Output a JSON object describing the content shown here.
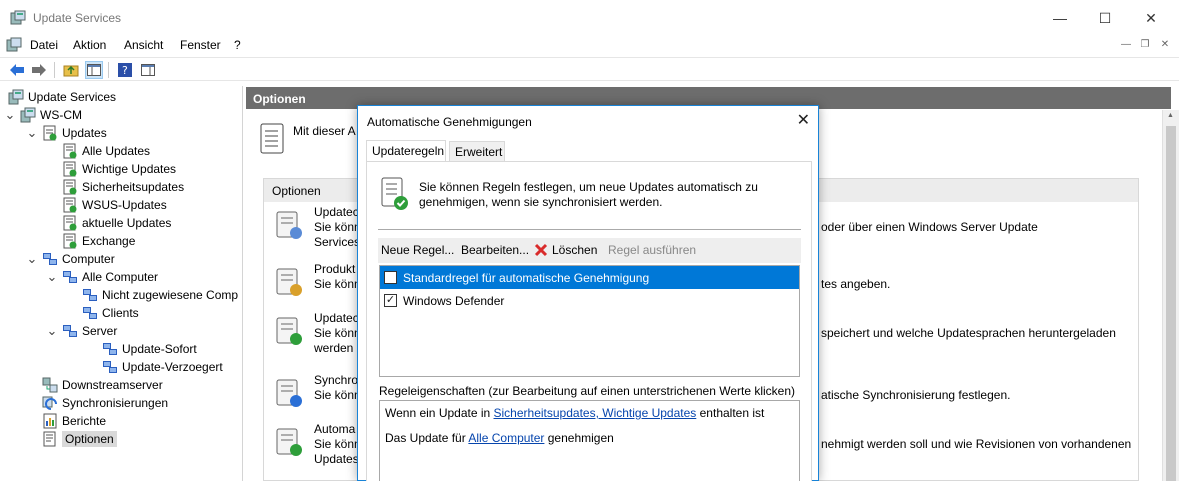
{
  "window": {
    "title": "Update Services"
  },
  "menu": {
    "items": [
      "Datei",
      "Aktion",
      "Ansicht",
      "Fenster",
      "?"
    ]
  },
  "tree": {
    "nodes": [
      {
        "label": "Update Services",
        "icon": "server-icon",
        "chev": ""
      },
      {
        "label": "WS-CM",
        "icon": "server-icon",
        "chev": "down"
      },
      {
        "label": "Updates",
        "icon": "updates-icon",
        "chev": "down"
      },
      {
        "label": "Alle Updates",
        "icon": "update-list-icon",
        "chev": ""
      },
      {
        "label": "Wichtige Updates",
        "icon": "update-list-icon",
        "chev": ""
      },
      {
        "label": "Sicherheitsupdates",
        "icon": "update-list-icon",
        "chev": ""
      },
      {
        "label": "WSUS-Updates",
        "icon": "update-list-icon",
        "chev": ""
      },
      {
        "label": "aktuelle Updates",
        "icon": "update-list-icon",
        "chev": ""
      },
      {
        "label": "Exchange",
        "icon": "update-list-icon",
        "chev": ""
      },
      {
        "label": "Computer",
        "icon": "computers-icon",
        "chev": "down"
      },
      {
        "label": "Alle Computer",
        "icon": "computers-icon",
        "chev": "down"
      },
      {
        "label": "Nicht zugewiesene Comp",
        "icon": "computers-icon",
        "chev": ""
      },
      {
        "label": "Clients",
        "icon": "computers-icon",
        "chev": ""
      },
      {
        "label": "Server",
        "icon": "computers-icon",
        "chev": "down"
      },
      {
        "label": "Update-Sofort",
        "icon": "computers-icon",
        "chev": ""
      },
      {
        "label": "Update-Verzoegert",
        "icon": "computers-icon",
        "chev": ""
      },
      {
        "label": "Downstreamserver",
        "icon": "downstream-icon",
        "chev": ""
      },
      {
        "label": "Synchronisierungen",
        "icon": "sync-icon",
        "chev": ""
      },
      {
        "label": "Berichte",
        "icon": "reports-icon",
        "chev": ""
      },
      {
        "label": "Optionen",
        "icon": "options-icon",
        "chev": ""
      }
    ]
  },
  "main": {
    "header": "Optionen",
    "intro": "Mit dieser A",
    "options_header": "Optionen",
    "options": [
      {
        "title": "Updatec",
        "line1": "Sie könn",
        "line2": "Services",
        "right": "oder über einen Windows Server Update"
      },
      {
        "title": "Produkt",
        "line1": "Sie könn",
        "line2": "",
        "right": "tes angeben."
      },
      {
        "title": "Updatec",
        "line1": "Sie könn",
        "line2": "werden",
        "right": "speichert und welche Updatesprachen heruntergeladen"
      },
      {
        "title": "Synchro",
        "line1": "Sie könn",
        "line2": "",
        "right": "atische Synchronisierung festlegen."
      },
      {
        "title": "Automa",
        "line1": "Sie könn",
        "line2": "Updates",
        "right": "nehmigt werden soll und wie Revisionen von vorhandenen"
      }
    ]
  },
  "dialog": {
    "title": "Automatische Genehmigungen",
    "tabs": [
      "Updateregeln",
      "Erweitert"
    ],
    "description_line1": "Sie können Regeln festlegen, um neue Updates automatisch zu",
    "description_line2": "genehmigen, wenn sie synchronisiert werden.",
    "toolbar": {
      "new_rule": "Neue Regel...",
      "edit": "Bearbeiten...",
      "delete": "Löschen",
      "run_rule": "Regel ausführen"
    },
    "rules": [
      {
        "label": "Standardregel für automatische Genehmigung",
        "checked": false,
        "selected": true
      },
      {
        "label": "Windows Defender",
        "checked": true,
        "selected": false
      }
    ],
    "properties_label": "Regeleigenschaften (zur Bearbeitung auf einen unterstrichenen Werte klicken)",
    "prop1": {
      "prefix": "Wenn ein Update in ",
      "link": "Sicherheitsupdates, Wichtige Updates",
      "suffix": " enthalten ist"
    },
    "prop2": {
      "prefix": "Das Update für ",
      "link": "Alle Computer",
      "suffix": " genehmigen"
    }
  },
  "colors": {
    "accent": "#0078d7",
    "header_bar": "#6d6d6d",
    "link": "#0645ad"
  }
}
